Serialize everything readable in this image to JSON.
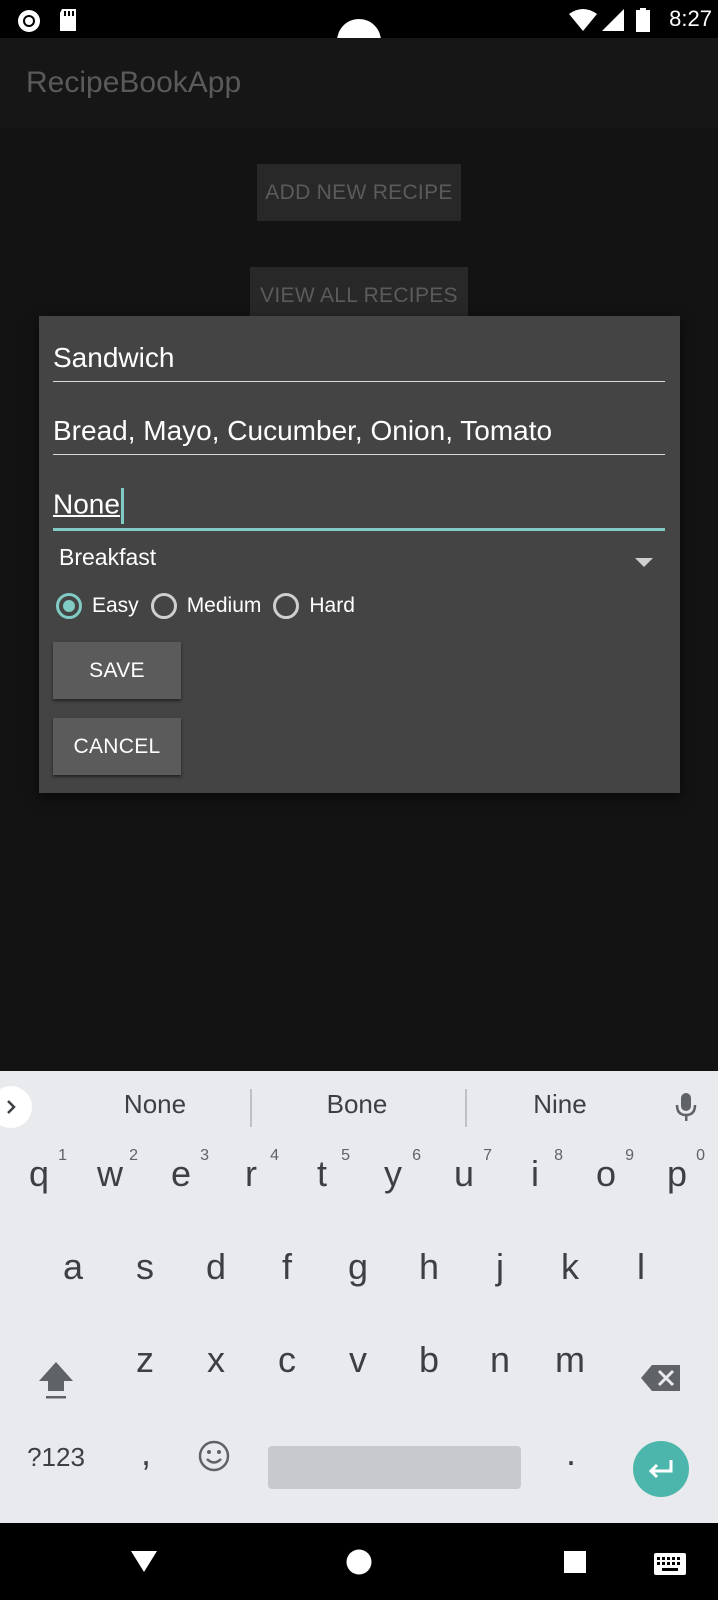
{
  "status_bar": {
    "time": "8:27"
  },
  "app": {
    "title": "RecipeBookApp"
  },
  "background_buttons": {
    "add_new": "ADD NEW RECIPE",
    "view_all": "VIEW ALL RECIPES"
  },
  "dialog": {
    "name_value": "Sandwich",
    "ingredients_value": "Bread, Mayo, Cucumber, Onion, Tomato",
    "allergens_value": "None",
    "category_selected": "Breakfast",
    "difficulty_options": [
      "Easy",
      "Medium",
      "Hard"
    ],
    "difficulty_selected": "Easy",
    "save_label": "SAVE",
    "cancel_label": "CANCEL"
  },
  "keyboard": {
    "suggestions": [
      "None",
      "Bone",
      "Nine"
    ],
    "row1": [
      "q",
      "w",
      "e",
      "r",
      "t",
      "y",
      "u",
      "i",
      "o",
      "p"
    ],
    "row1_numbers": [
      "1",
      "2",
      "3",
      "4",
      "5",
      "6",
      "7",
      "8",
      "9",
      "0"
    ],
    "row2": [
      "a",
      "s",
      "d",
      "f",
      "g",
      "h",
      "j",
      "k",
      "l"
    ],
    "row3": [
      "z",
      "x",
      "c",
      "v",
      "b",
      "n",
      "m"
    ],
    "symbols_label": "?123",
    "comma": ",",
    "period": ".",
    "accent_color": "#4db6ac"
  },
  "colors": {
    "accent": "#80cbc4",
    "dialog_bg": "#444444"
  }
}
